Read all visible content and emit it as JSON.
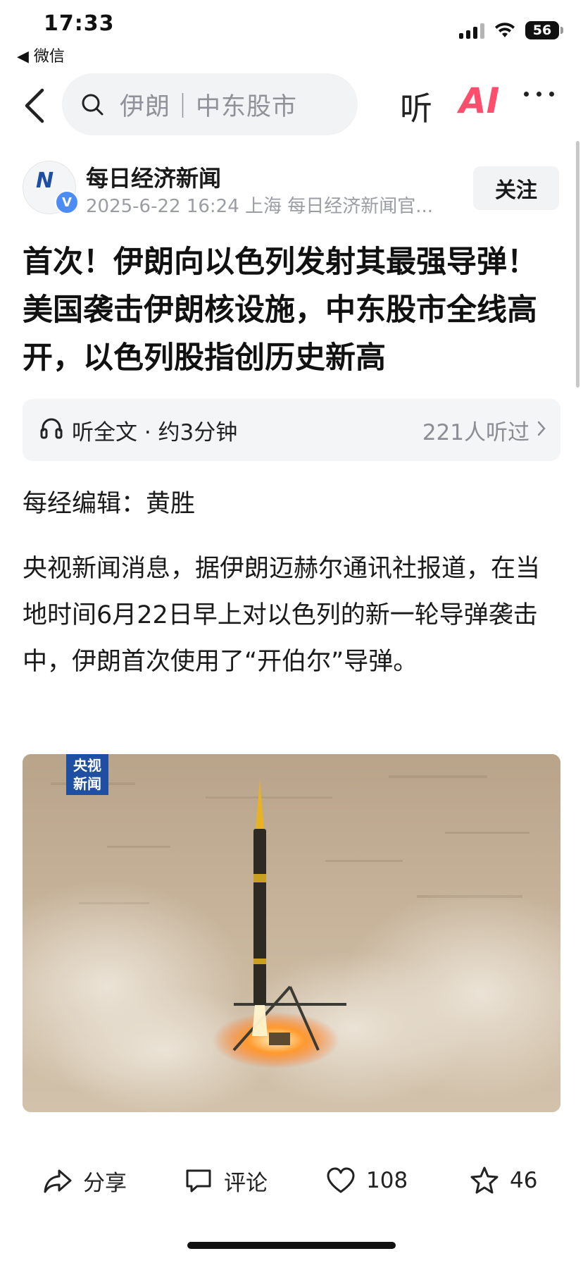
{
  "status_bar": {
    "time": "17:33",
    "back_app": "◀ 微信",
    "battery": "56"
  },
  "nav": {
    "search_text": "伊朗｜中东股市",
    "listen_label": "听",
    "ai_label": "AI"
  },
  "author": {
    "name": "每日经济新闻",
    "meta": "2025-6-22 16:24 上海 每日经济新闻官...",
    "verified_mark": "V",
    "follow_label": "关注"
  },
  "article": {
    "headline": "首次！伊朗向以色列发射其最强导弹！美国袭击伊朗核设施，中东股市全线高开，以色列股指创历史新高",
    "listen_card": {
      "label": "听全文 · 约3分钟",
      "count": "221人听过"
    },
    "editor": "每经编辑：黄胜",
    "body": "央视新闻消息，据伊朗迈赫尔通讯社报道，在当地时间6月22日早上对以色列的新一轮导弹袭击中，伊朗首次使用了“开伯尔”导弹。",
    "image_logo_line1": "央视",
    "image_logo_line2": "新闻"
  },
  "actions": {
    "share_label": "分享",
    "comment_label": "评论",
    "like_count": "108",
    "favorite_count": "46"
  }
}
